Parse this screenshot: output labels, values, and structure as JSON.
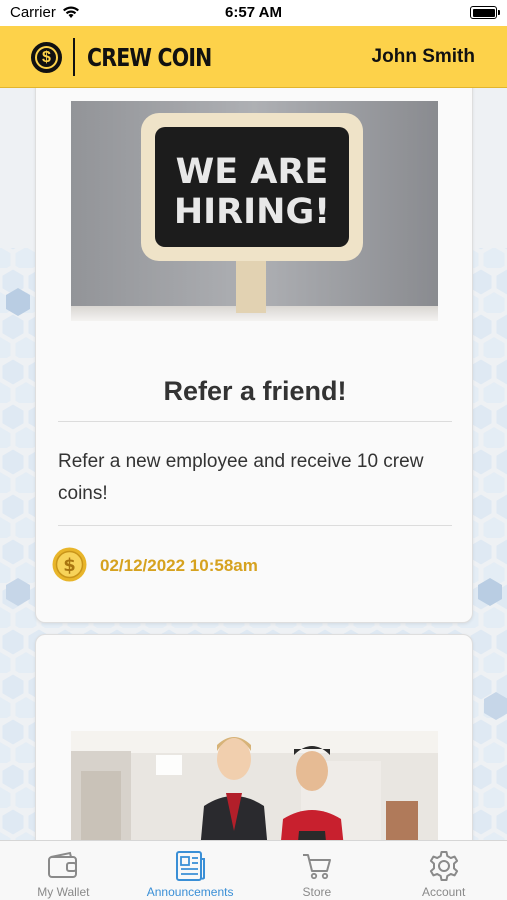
{
  "status_bar": {
    "carrier": "Carrier",
    "time": "6:57 AM"
  },
  "header": {
    "brand": "CREW COIN",
    "user_name": "John Smith",
    "coin_symbol": "$"
  },
  "announcements": [
    {
      "image_text": "WE ARE HIRING!",
      "title": "Refer a friend!",
      "description": "Refer a new employee and receive 10 crew coins!",
      "date": "02/12/2022 10:58am",
      "coin_symbol": "$"
    },
    {
      "image_text": "",
      "title": "",
      "description": "",
      "date": ""
    }
  ],
  "tabs": [
    {
      "label": "My Wallet",
      "icon": "wallet-icon",
      "active": false
    },
    {
      "label": "Announcements",
      "icon": "newspaper-icon",
      "active": true
    },
    {
      "label": "Store",
      "icon": "cart-icon",
      "active": false
    },
    {
      "label": "Account",
      "icon": "gear-icon",
      "active": false
    }
  ],
  "colors": {
    "brand_yellow": "#fdd24a",
    "active_tab": "#3a8fd6",
    "inactive_tab": "#8a8a8a",
    "date_gold": "#d6a21f"
  }
}
